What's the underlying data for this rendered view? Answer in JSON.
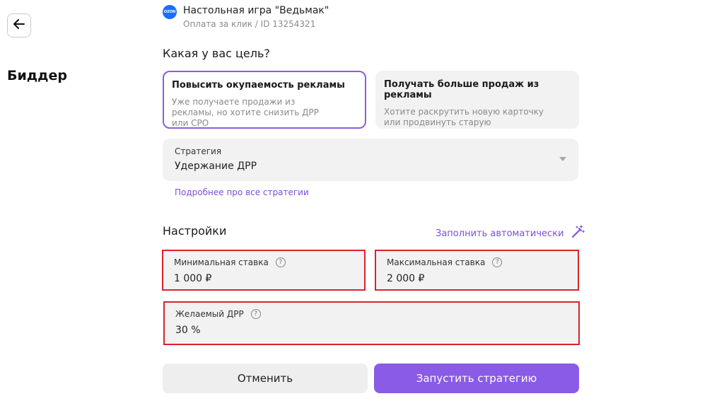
{
  "page": {
    "title": "Биддер",
    "back_icon": "arrow-left-icon"
  },
  "product": {
    "logo_text": "OZON",
    "name": "Настольная игра \"Ведьмак\"",
    "subtitle": "Оплата за клик / ID 13254321"
  },
  "goal": {
    "title": "Какая у вас цель?",
    "options": [
      {
        "title": "Повысить окупаемость рекламы",
        "desc": "Уже получаете продажи из рекламы, но хотите снизить ДРР или CPO",
        "selected": true
      },
      {
        "title": "Получать больше продаж из рекламы",
        "desc": "Хотите раскрутить новую карточку или продвинуть старую",
        "selected": false
      }
    ]
  },
  "strategy": {
    "label": "Стратегия",
    "value": "Удержание ДРР",
    "link": "Подробнее про все стратегии"
  },
  "settings": {
    "title": "Настройки",
    "autofill_label": "Заполнить автоматически",
    "autofill_icon": "magic-wand-icon",
    "min_bid": {
      "label": "Минимальная ставка",
      "value": "1 000 ₽"
    },
    "max_bid": {
      "label": "Максимальная ставка",
      "value": "2 000 ₽"
    },
    "target_drr": {
      "label": "Желаемый ДРР",
      "value": "30 %"
    },
    "help_glyph": "?"
  },
  "actions": {
    "cancel": "Отменить",
    "run": "Запустить стратегию"
  },
  "colors": {
    "accent": "#8a5be6",
    "highlight_border": "#d9232b",
    "ozon_blue": "#1a6dff"
  }
}
